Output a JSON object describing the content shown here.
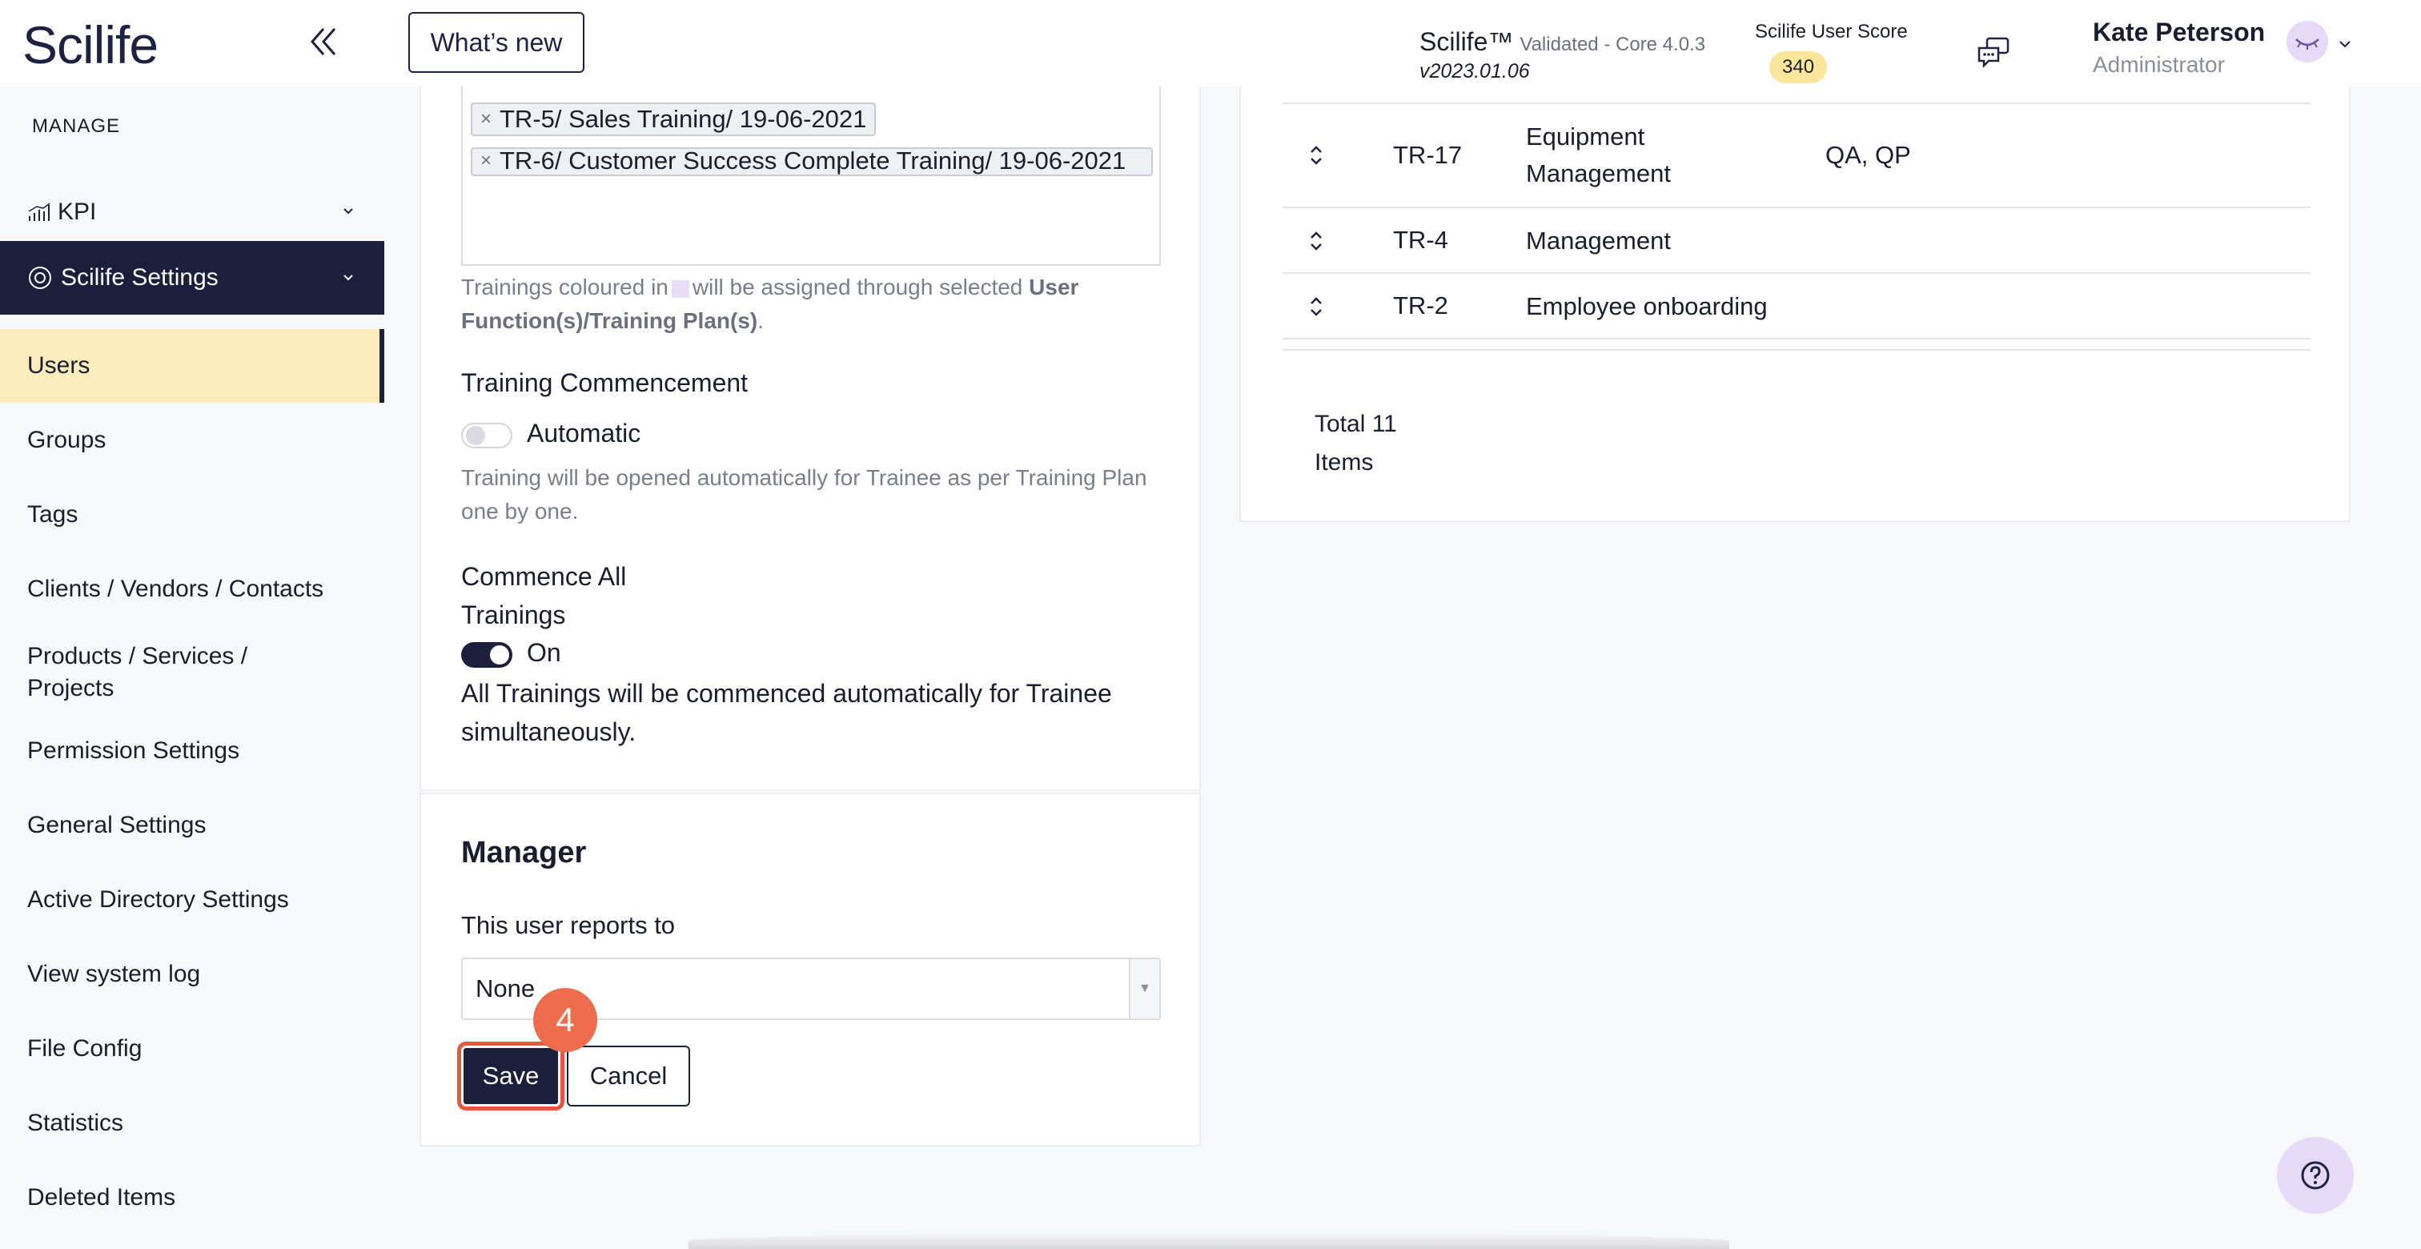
{
  "header": {
    "logo": "Scilife",
    "whats_new": "What’s new",
    "product_name": "Scilife™",
    "product_sub": "Validated - Core 4.0.3",
    "product_version": "v2023.01.06",
    "score_label": "Scilife User Score",
    "score_value": "340",
    "user_name": "Kate Peterson",
    "user_role": "Administrator"
  },
  "sidebar": {
    "section_label": "MANAGE",
    "kpi_label": "KPI",
    "settings_label": "Scilife Settings",
    "items": [
      {
        "label": "Users",
        "active": true
      },
      {
        "label": "Groups"
      },
      {
        "label": "Tags"
      },
      {
        "label": "Clients / Vendors / Contacts"
      },
      {
        "label": "Products / Services / Projects"
      },
      {
        "label": "Permission Settings"
      },
      {
        "label": "General Settings"
      },
      {
        "label": "Active Directory Settings"
      },
      {
        "label": "View system log"
      },
      {
        "label": "File Config"
      },
      {
        "label": "Statistics"
      },
      {
        "label": "Deleted Items"
      }
    ]
  },
  "form": {
    "chips": [
      "TR-5/ Sales Training/ 19-06-2021",
      "TR-6/ Customer Success Complete Training/ 19-06-2021"
    ],
    "chip_remove": "×",
    "colour_note_pre": "Trainings coloured in",
    "colour_note_mid": "will be assigned through selected",
    "colour_note_bold": "User Function(s)/Training Plan(s)",
    "colour_note_end": ".",
    "commencement_title": "Training Commencement",
    "automatic_label": "Automatic",
    "automatic_help": "Training will be opened automatically for Trainee as per Training Plan one by one.",
    "commence_all_title": "Commence All Trainings",
    "commence_all_state": "On",
    "commence_all_help": "All Trainings will be commenced automatically for Trainee simultaneously."
  },
  "manager": {
    "title": "Manager",
    "reports_label": "This user reports to",
    "reports_value": "None",
    "save_label": "Save",
    "cancel_label": "Cancel",
    "step_number": "4"
  },
  "table": {
    "rows": [
      {
        "id": "TR-17",
        "name": "Equipment Management",
        "groups": "QA, QP"
      },
      {
        "id": "TR-4",
        "name": "Management",
        "groups": ""
      },
      {
        "id": "TR-2",
        "name": "Employee onboarding",
        "groups": ""
      }
    ],
    "total": "Total 11 Items"
  },
  "colors": {
    "primary": "#1b1f3c",
    "active_nav": "#fdecbb",
    "score_badge": "#fbe79a",
    "highlight": "#ee6b4b",
    "assigned_swatch": "#e7ddf8"
  },
  "icons": [
    "collapse-icon",
    "chat-icon",
    "avatar-icon",
    "chevron-down-icon",
    "kpi-chart-icon",
    "settings-icon",
    "sort-icon",
    "help-icon"
  ]
}
